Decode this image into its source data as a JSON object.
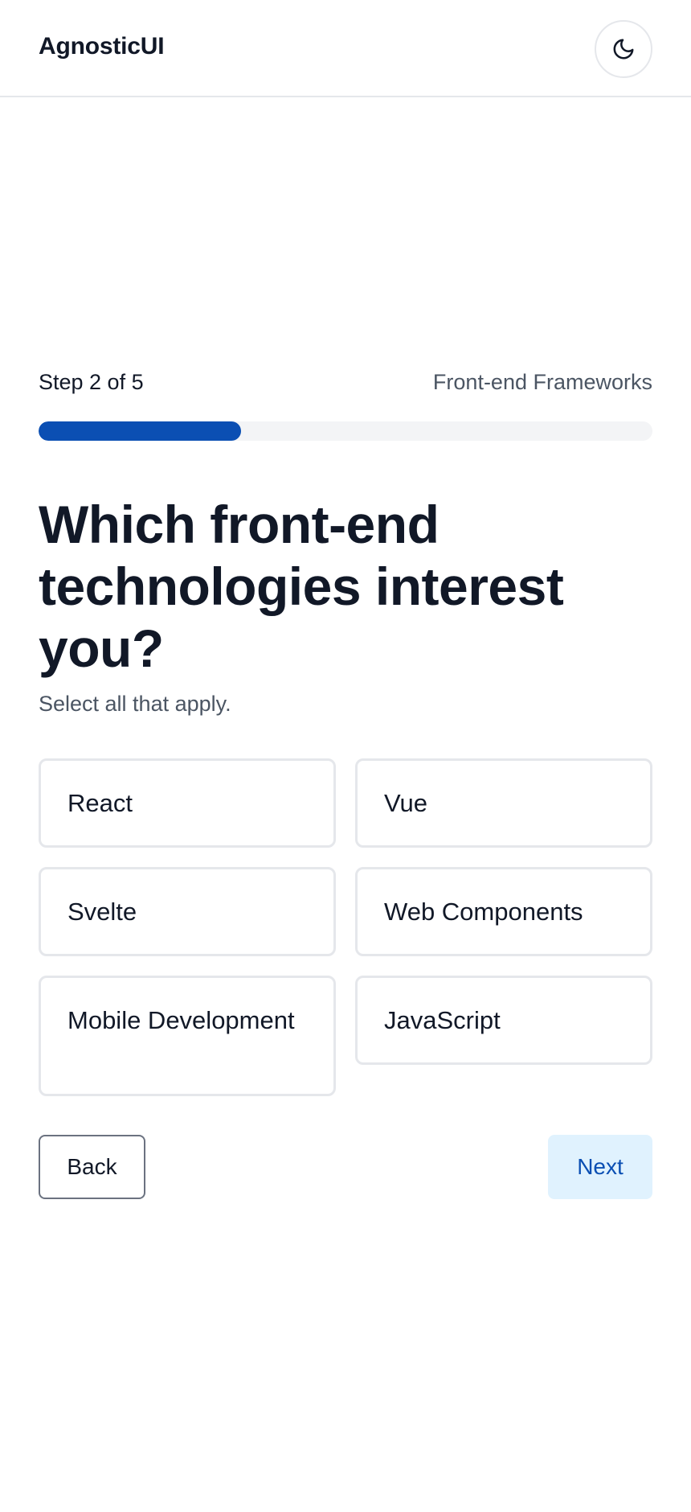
{
  "header": {
    "brand": "AgnosticUI",
    "theme_toggle_icon": "moon-icon"
  },
  "wizard": {
    "step_label": "Step 2 of 5",
    "step_name": "Front-end Frameworks",
    "progress_fraction": 0.33,
    "question": "Which front-end technologies interest you?",
    "hint": "Select all that apply.",
    "options": [
      {
        "label": "React"
      },
      {
        "label": "Vue"
      },
      {
        "label": "Svelte"
      },
      {
        "label": "Web Components"
      },
      {
        "label": "Mobile Development"
      },
      {
        "label": "JavaScript"
      }
    ],
    "back_label": "Back",
    "next_label": "Next"
  },
  "colors": {
    "progress_fill": "#0b4fb3",
    "progress_track": "#f3f4f6",
    "next_bg": "#e0f2fe",
    "next_text": "#0b4fb3"
  }
}
